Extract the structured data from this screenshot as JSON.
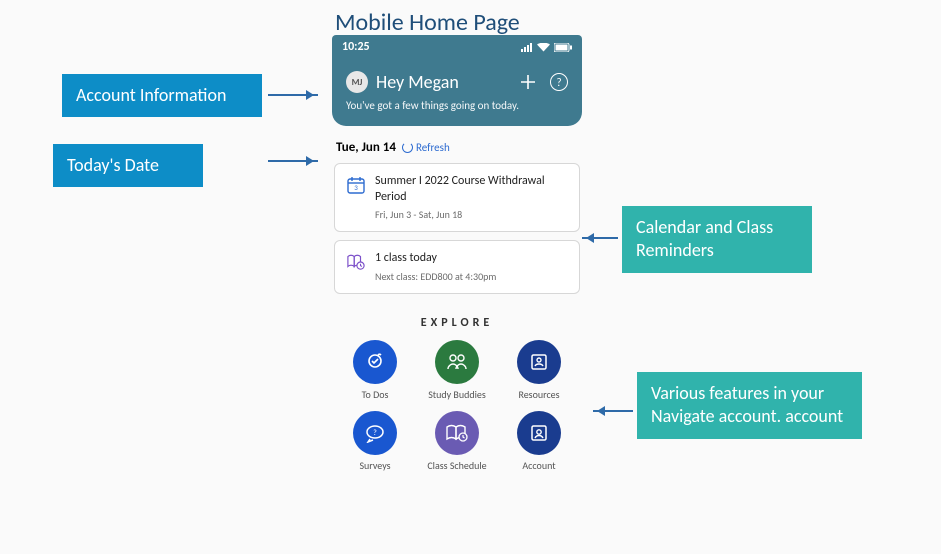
{
  "page_title": "Mobile Home Page",
  "callouts": {
    "account": "Account Information",
    "today": "Today's Date",
    "reminders": "Calendar and Class Reminders",
    "features": "Various features in your Navigate account. account"
  },
  "statusbar": {
    "time": "10:25"
  },
  "header": {
    "avatar_initials": "MJ",
    "greeting": "Hey Megan",
    "subgreeting": "You've got a few things going on today."
  },
  "date": {
    "label": "Tue, Jun 14",
    "refresh_label": "Refresh"
  },
  "cards": {
    "withdrawal": {
      "title": "Summer I 2022 Course Withdrawal Period",
      "sub": "Fri, Jun 3 - Sat, Jun 18"
    },
    "class": {
      "title": "1 class today",
      "sub": "Next class: EDD800 at 4:30pm"
    }
  },
  "explore": {
    "heading": "EXPLORE",
    "items": {
      "todos": "To Dos",
      "buddies": "Study Buddies",
      "resources": "Resources",
      "surveys": "Surveys",
      "schedule": "Class Schedule",
      "account": "Account"
    }
  }
}
